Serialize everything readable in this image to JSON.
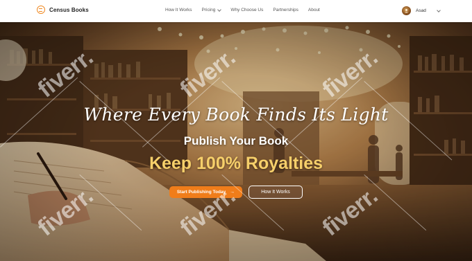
{
  "brand": {
    "name": "Census Books",
    "accent": "#f08a24"
  },
  "nav": {
    "links": [
      {
        "label": "How It Works"
      },
      {
        "label": "Pricing",
        "has_dropdown": true
      },
      {
        "label": "Why Choose Us"
      },
      {
        "label": "Partnerships"
      },
      {
        "label": "About"
      }
    ]
  },
  "user": {
    "name": "Asad",
    "avatar_icon": "user-avatar",
    "menu_icon": "chevron-down-icon"
  },
  "hero": {
    "tagline": "Where Every Book Finds Its Light",
    "headline": "Publish Your Book",
    "subheadline": "Keep 100% Royalties",
    "primary_cta": {
      "label": "Start Publishing Today",
      "icon": "arrow-right-icon",
      "color": "#f07d1a"
    },
    "secondary_cta": {
      "label": "How It Works"
    },
    "subheadline_color": "#f6cf6a"
  },
  "watermark": {
    "text": "fiverr."
  }
}
